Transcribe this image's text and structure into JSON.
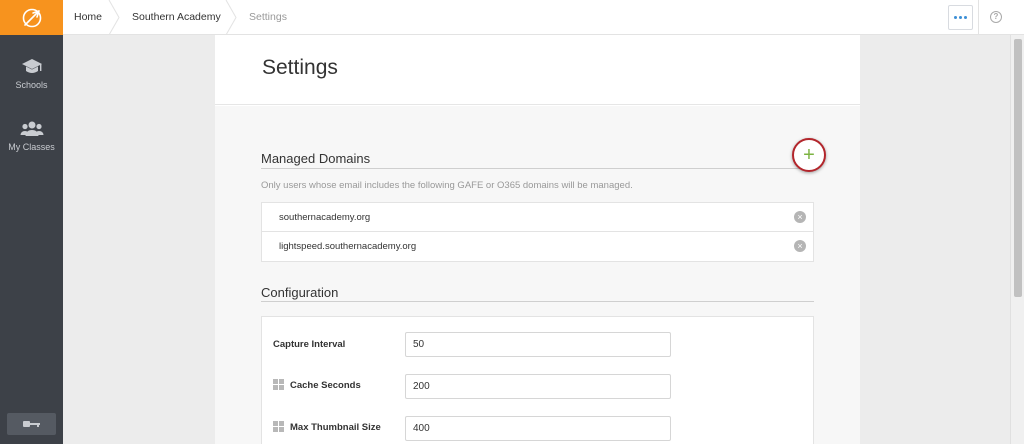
{
  "sidebar": {
    "logo_icon": "compass-logo-icon",
    "items": [
      {
        "label": "Schools",
        "icon": "graduation-cap-icon"
      },
      {
        "label": "My Classes",
        "icon": "users-icon"
      }
    ],
    "logout_icon": "key-icon"
  },
  "breadcrumb": {
    "items": [
      "Home",
      "Southern Academy",
      "Settings"
    ]
  },
  "toolbar": {
    "more_icon": "ellipsis-icon",
    "help_icon_glyph": "?"
  },
  "page": {
    "title": "Settings"
  },
  "managed_domains": {
    "title": "Managed Domains",
    "add_glyph": "+",
    "hint": "Only users whose email includes the following GAFE or O365 domains will be managed.",
    "domains": [
      "southernacademy.org",
      "lightspeed.southernacademy.org"
    ],
    "remove_glyph": "×"
  },
  "configuration": {
    "title": "Configuration",
    "fields": [
      {
        "label": "Capture Interval",
        "value": "50",
        "windows_only": false
      },
      {
        "label": "Cache Seconds",
        "value": "200",
        "windows_only": true
      },
      {
        "label": "Max Thumbnail Size",
        "value": "400",
        "windows_only": true
      }
    ]
  },
  "colors": {
    "brand_orange": "#f7931e",
    "sidebar_bg": "#3d4148",
    "add_ring": "#b3262c",
    "add_plus": "#7cb342",
    "accent_blue": "#3c8fd6"
  }
}
